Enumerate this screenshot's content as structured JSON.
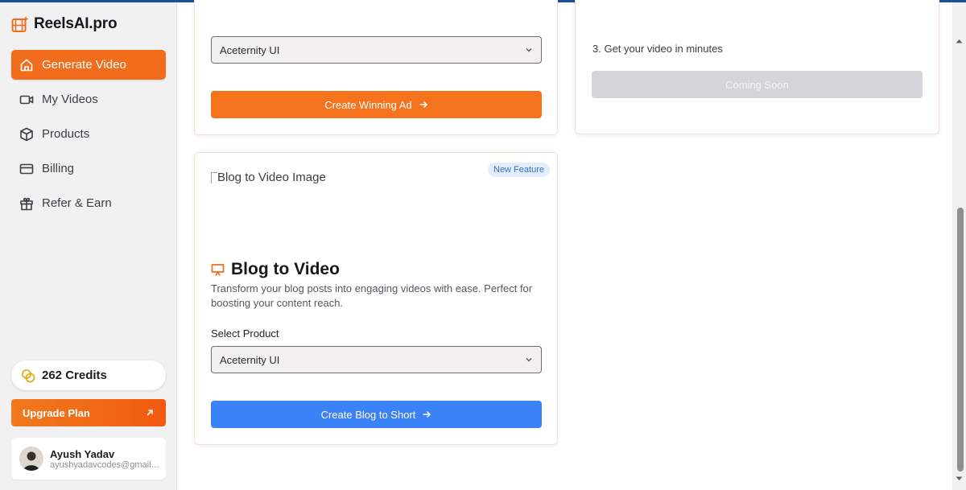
{
  "app": {
    "brand": "ReelsAI.pro"
  },
  "sidebar": {
    "items": [
      {
        "label": "Generate Video",
        "icon": "home-icon"
      },
      {
        "label": "My Videos",
        "icon": "video-camera-icon"
      },
      {
        "label": "Products",
        "icon": "box-icon"
      },
      {
        "label": "Billing",
        "icon": "credit-card-icon"
      },
      {
        "label": "Refer & Earn",
        "icon": "gift-icon"
      }
    ],
    "credits": "262 Credits",
    "upgrade_label": "Upgrade Plan",
    "user": {
      "name": "Ayush Yadav",
      "email": "ayushyadavcodes@gmail.com"
    }
  },
  "winning_ad": {
    "select_value": "Aceternity UI",
    "button_label": "Create Winning Ad"
  },
  "coming_soon": {
    "step": "3. Get your video in minutes",
    "button_label": "Coming Soon"
  },
  "blog_to_video": {
    "badge": "New Feature",
    "image_alt": "Blog to Video Image",
    "title": "Blog to Video",
    "description": "Transform your blog posts into engaging videos with ease. Perfect for boosting your content reach.",
    "select_label": "Select Product",
    "select_value": "Aceternity UI",
    "button_label": "Create Blog to Short"
  },
  "colors": {
    "accent": "#f26d1b",
    "primary_blue": "#3b82f6",
    "disabled": "#d3d5d9"
  }
}
